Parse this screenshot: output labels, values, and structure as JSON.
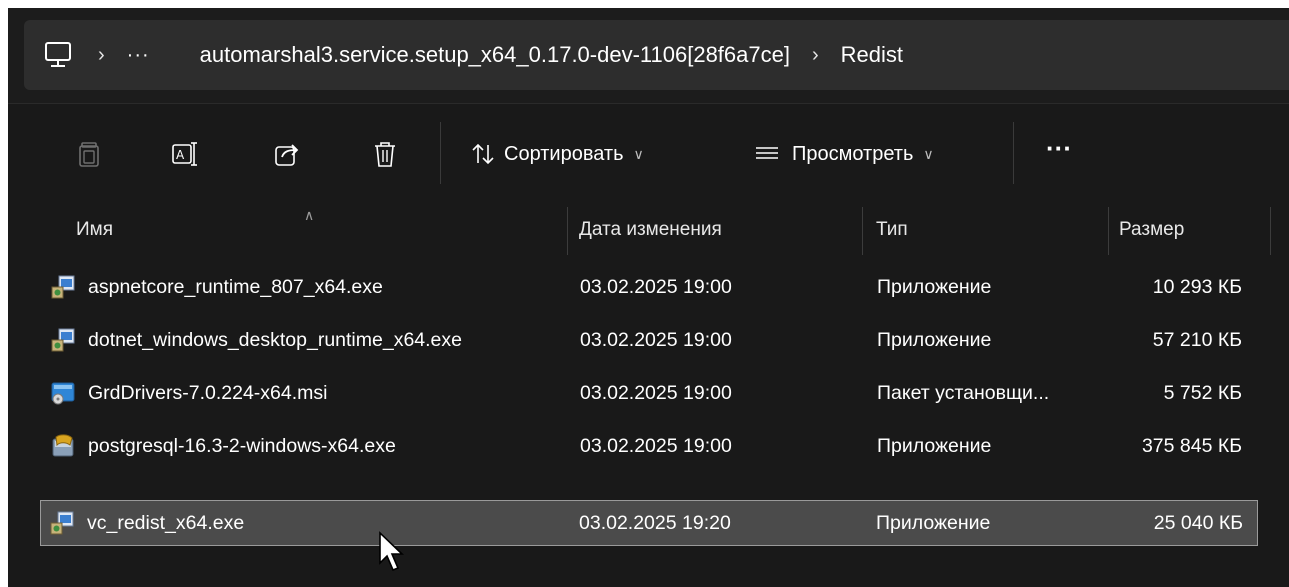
{
  "breadcrumb": {
    "more": "···",
    "items": [
      "automarshal3.service.setup_x64_0.17.0-dev-1106[28f6a7ce]",
      "Redist"
    ]
  },
  "toolbar": {
    "sort_label": "Сортировать",
    "view_label": "Просмотреть",
    "more_label": "···"
  },
  "columns": {
    "name": "Имя",
    "date": "Дата изменения",
    "type": "Тип",
    "size": "Размер"
  },
  "files": [
    {
      "name": "aspnetcore_runtime_807_x64.exe",
      "date": "03.02.2025 19:00",
      "type": "Приложение",
      "size": "10 293 КБ",
      "icon": "installer-exe-icon",
      "selected": false
    },
    {
      "name": "dotnet_windows_desktop_runtime_x64.exe",
      "date": "03.02.2025 19:00",
      "type": "Приложение",
      "size": "57 210 КБ",
      "icon": "installer-exe-icon",
      "selected": false
    },
    {
      "name": "GrdDrivers-7.0.224-x64.msi",
      "date": "03.02.2025 19:00",
      "type": "Пакет установщи...",
      "size": "5 752 КБ",
      "icon": "msi-package-icon",
      "selected": false
    },
    {
      "name": "postgresql-16.3-2-windows-x64.exe",
      "date": "03.02.2025 19:00",
      "type": "Приложение",
      "size": "375 845 КБ",
      "icon": "postgresql-app-icon",
      "selected": false
    },
    {
      "name": "vc_redist_x64.exe",
      "date": "03.02.2025 19:20",
      "type": "Приложение",
      "size": "25 040 КБ",
      "icon": "installer-exe-icon",
      "selected": true
    }
  ],
  "colors": {
    "window_bg": "#191919",
    "selection_bg": "#4b4b4b",
    "text": "#ffffff"
  }
}
